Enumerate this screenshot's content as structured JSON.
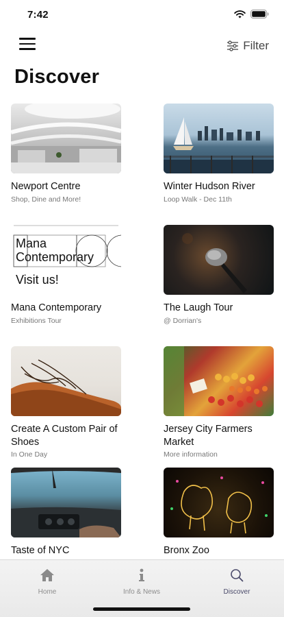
{
  "status_bar": {
    "time": "7:42"
  },
  "top_nav": {
    "filter_label": "Filter"
  },
  "page": {
    "title": "Discover"
  },
  "cards": [
    {
      "title": "Newport Centre",
      "subtitle": "Shop, Dine and More!"
    },
    {
      "title": "Winter Hudson River",
      "subtitle": "Loop Walk - Dec 11th"
    },
    {
      "title": "Mana Contemporary",
      "subtitle": "Exhibitions Tour",
      "image_text": {
        "line1": "Mana",
        "line2": "Contemporary",
        "line3": "Visit us!"
      }
    },
    {
      "title": "The Laugh Tour",
      "subtitle": "@ Dorrian's"
    },
    {
      "title": "Create A Custom Pair of Shoes",
      "subtitle": "In One Day"
    },
    {
      "title": "Jersey City Farmers Market",
      "subtitle": "More information"
    },
    {
      "title": "Taste of NYC",
      "subtitle": ""
    },
    {
      "title": "Bronx Zoo",
      "subtitle": ""
    }
  ],
  "tab_bar": {
    "tabs": [
      {
        "label": "Home",
        "icon": "home-icon"
      },
      {
        "label": "Info & News",
        "icon": "info-icon"
      },
      {
        "label": "Discover",
        "icon": "search-icon"
      }
    ],
    "active": "Discover"
  }
}
